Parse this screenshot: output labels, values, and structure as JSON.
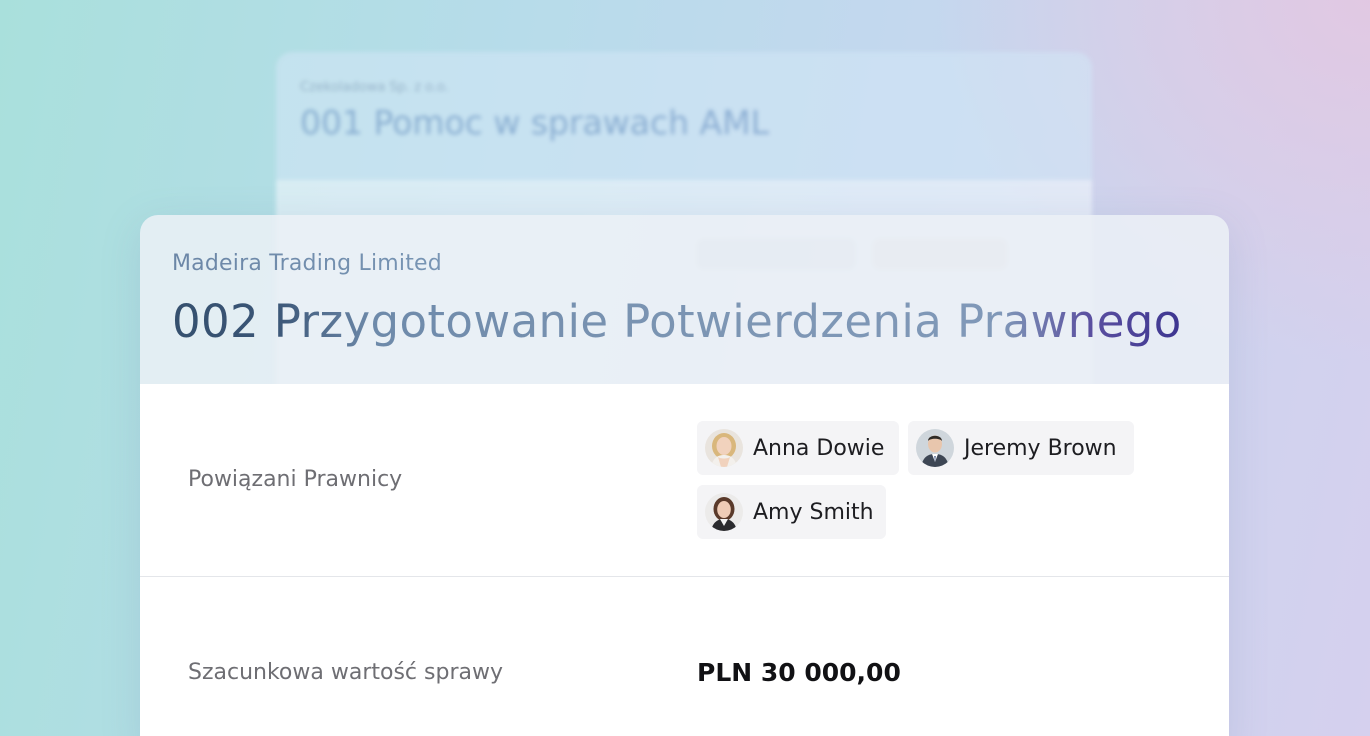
{
  "background_card": {
    "client": "Czekoladowa Sp. z o.o.",
    "title": "001 Pomoc w sprawach AML"
  },
  "case": {
    "client": "Madeira Trading Limited",
    "title": "002 Przygotowanie Potwierdzenia Prawnego"
  },
  "lawyers": {
    "label": "Powiązani Prawnicy",
    "people": [
      {
        "name": "Anna Dowie",
        "avatar": "female-blonde-avatar"
      },
      {
        "name": "Jeremy Brown",
        "avatar": "male-suit-avatar"
      },
      {
        "name": "Amy Smith",
        "avatar": "female-dark-hair-avatar"
      }
    ]
  },
  "estimated_value": {
    "label": "Szacunkowa wartość sprawy",
    "value": "PLN 30 000,00"
  },
  "colors": {
    "title_start": "#35506e",
    "title_end": "#3d3590",
    "accent_background": "#b7dcea"
  }
}
